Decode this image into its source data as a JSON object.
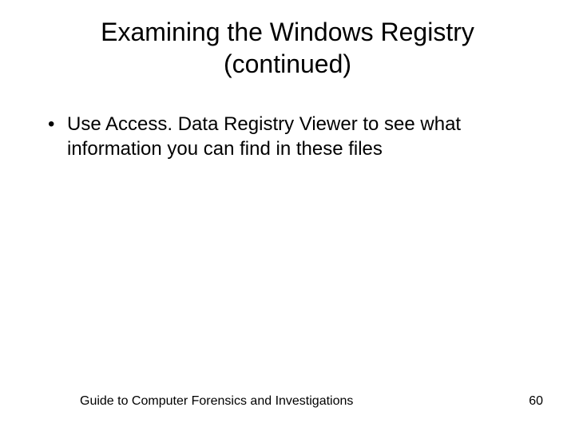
{
  "title_line1": "Examining the Windows Registry",
  "title_line2": "(continued)",
  "bullets": [
    "Use Access. Data Registry Viewer to see what information you can find in these files"
  ],
  "footer": {
    "left": "Guide to Computer Forensics and Investigations",
    "right": "60"
  }
}
